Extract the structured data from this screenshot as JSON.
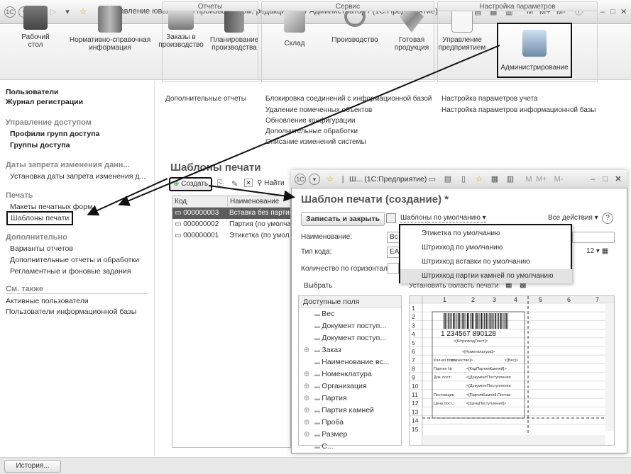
{
  "window": {
    "title": "Управление ювелирным производством, редакция 5.0 / Администратор / (1С:Предприятие)",
    "right_controls": [
      "M",
      "M+",
      "M-"
    ]
  },
  "sections": [
    {
      "label": "Рабочий\nстол",
      "icon": "desktop-icon"
    },
    {
      "label": "Нормативно-справочная\nинформация",
      "icon": "books-icon"
    },
    {
      "label": "Заказы в\nпроизводство",
      "icon": "printer-icon"
    },
    {
      "label": "Планирование\nпроизводства",
      "icon": "binder-icon"
    },
    {
      "label": "Склад",
      "icon": "box-icon"
    },
    {
      "label": "Производство",
      "icon": "ring-icon"
    },
    {
      "label": "Готовая\nпродукция",
      "icon": "crystal-icon"
    },
    {
      "label": "Управление\nпредприятием",
      "icon": "chart-icon"
    },
    {
      "label": "Администрирование",
      "icon": "computer-icon"
    }
  ],
  "left": {
    "top_links": [
      "Пользователи",
      "Журнал регистрации"
    ],
    "access_header": "Управление доступом",
    "access_links": [
      "Профили групп доступа",
      "Группы доступа"
    ],
    "date_header": "Даты запрета изменения данн...",
    "date_links": [
      "Установка даты запрета изменения д..."
    ],
    "print_header": "Печать",
    "print_links": [
      "Макеты печатных форм",
      "Шаблоны печати"
    ],
    "extra_header": "Дополнительно",
    "extra_links": [
      "Варианты отчетов",
      "Дополнительные отчеты и обработки",
      "Регламентные и фоновые задания"
    ],
    "see_header": "См. также",
    "see_links": [
      "Активные пользователи",
      "Пользователи информационной базы"
    ]
  },
  "services": {
    "reports_header": "Отчеты",
    "reports": [
      "Дополнительные отчеты"
    ],
    "service_header": "Сервис",
    "service": [
      "Блокировка соединений с информационной базой",
      "Удаление помеченных объектов",
      "Обновление конфигурации",
      "Дополнительные обработки",
      "Описание изменений системы"
    ],
    "settings_header": "Настройка параметров",
    "settings": [
      "Настройка параметров учета",
      "Настройка параметров информационной базы"
    ]
  },
  "list": {
    "title": "Шаблоны печати",
    "create_label": "Создать",
    "find_label": "Найти",
    "columns": [
      "Код",
      "Наименование"
    ],
    "rows": [
      [
        "000000003",
        "Вставка без партии"
      ],
      [
        "000000002",
        "Партия (по умолча"
      ],
      [
        "000000001",
        "Этикетка (по умол"
      ]
    ]
  },
  "dialog": {
    "window_title": "Ш... (1С:Предприятие)",
    "title": "Шаблон печати (создание) *",
    "save_close": "Записать и закрыть",
    "templates_dropdown": "Шаблоны по умолчанию",
    "all_actions": "Все действия",
    "help": "?",
    "name_label": "Наименование:",
    "name_value": "Вс",
    "code_type_label": "Тип кода:",
    "code_type_value": "EA",
    "horizontal_label": "Количество по горизонтали:",
    "count_value": "12",
    "select_label": "Выбрать",
    "set_area_label": "Установить область печати",
    "menu_items": [
      "Этикетка по умолчанию",
      "Штрихкод по умолчанию",
      "Штрихкод вставки по умолчанию",
      "Штрихкод партии камней по умолчанию"
    ],
    "tree_header": "Доступные поля",
    "tree_items": [
      [
        "",
        "Вес"
      ],
      [
        "",
        "Документ поступ..."
      ],
      [
        "",
        "Документ поступ..."
      ],
      [
        "⊕",
        "Заказ"
      ],
      [
        "",
        "Наименование вс..."
      ],
      [
        "⊕",
        "Номенклатура"
      ],
      [
        "⊕",
        "Организация"
      ],
      [
        "⊕",
        "Партия"
      ],
      [
        "⊕",
        "Партия камней"
      ],
      [
        "⊕",
        "Проба"
      ],
      [
        "⊕",
        "Размер"
      ],
      [
        "",
        "С..."
      ]
    ],
    "sheet_cols": [
      "1",
      "2",
      "3",
      "4",
      "5",
      "6",
      "7"
    ],
    "sheet_rows": [
      "1",
      "2",
      "3",
      "4",
      "5",
      "6",
      "7",
      "8",
      "9",
      "10",
      "11",
      "12",
      "13",
      "14",
      "15"
    ],
    "barcode_digits": "1 234567 890128",
    "cells": {
      "barcode_text": "<[ШтрихкодТекст]>",
      "nomen": "<[Номенклатура]>",
      "qty_label": "Кол-во пост.",
      "qty": "оличество]>",
      "weight": "<[Вес]>",
      "batch_label": "Партия №",
      "batch": "<[КодПартииКамней]>",
      "doc_label": "Док. пост.:",
      "doc1": "<[ДокументПоступления",
      "doc2": "<[ДокументПоступления",
      "supplier_label": "Поставщик:",
      "supplier": "<[ПартияКамней.Постав",
      "price_label": "Цена пост.:",
      "price": "<[ЦенаПоступления]>"
    }
  },
  "status": {
    "history": "История..."
  }
}
